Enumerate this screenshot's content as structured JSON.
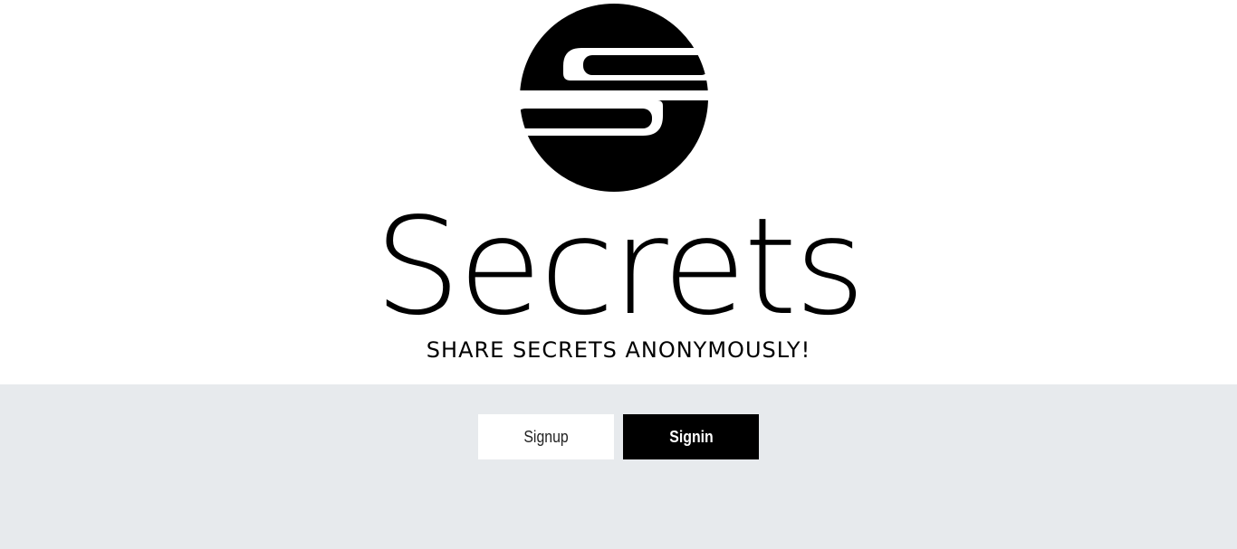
{
  "brand": {
    "name": "Secrets",
    "tagline": "SHARE SECRETS ANONYMOUSLY!",
    "logo_icon": "secrets-s-logo-icon"
  },
  "actions": {
    "signup_label": "Signup",
    "signin_label": "Signin"
  },
  "colors": {
    "hero_background": "#ffffff",
    "actions_background": "#e7eaed",
    "signup_background": "#ffffff",
    "signin_background": "#000000",
    "brand_ink": "#000000"
  }
}
